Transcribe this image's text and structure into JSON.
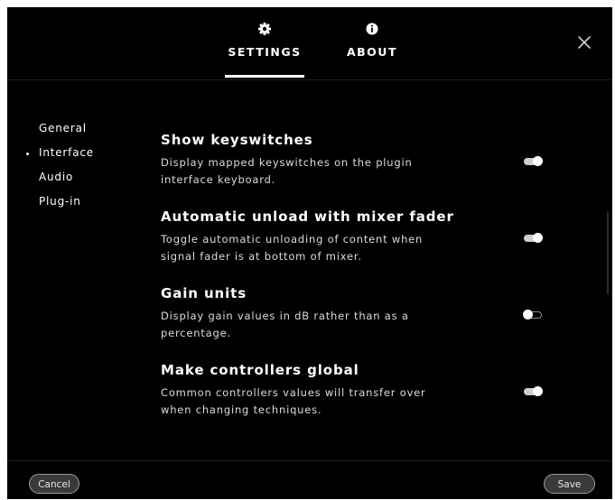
{
  "tabs": {
    "settings": {
      "label": "SETTINGS",
      "icon": "gear-icon",
      "active": true
    },
    "about": {
      "label": "ABOUT",
      "icon": "info-icon",
      "active": false
    }
  },
  "sidebar": {
    "items": [
      {
        "label": "General",
        "selected": false
      },
      {
        "label": "Interface",
        "selected": true
      },
      {
        "label": "Audio",
        "selected": false
      },
      {
        "label": "Plug-in",
        "selected": false
      }
    ]
  },
  "settings": [
    {
      "title": "Show keyswitches",
      "desc_line1": "Display mapped keyswitches on the plugin",
      "desc_line2": "interface keyboard.",
      "enabled": true
    },
    {
      "title": "Automatic unload with mixer fader",
      "desc_line1": "Toggle automatic unloading of content when",
      "desc_line2": "signal fader is at bottom of mixer.",
      "enabled": true
    },
    {
      "title": "Gain units",
      "desc_line1": "Display gain values in dB rather than as a",
      "desc_line2": "percentage.",
      "enabled": false
    },
    {
      "title": "Make controllers global",
      "desc_line1": "Common controllers values will transfer over",
      "desc_line2": "when changing techniques.",
      "enabled": true
    }
  ],
  "footer": {
    "cancel_label": "Cancel",
    "save_label": "Save"
  },
  "colors": {
    "background": "#000000",
    "text": "#ffffff",
    "description_text": "#dcdcdc",
    "toggle_on_track": "#cfcfcf",
    "button_fill": "#3a3a3a"
  }
}
